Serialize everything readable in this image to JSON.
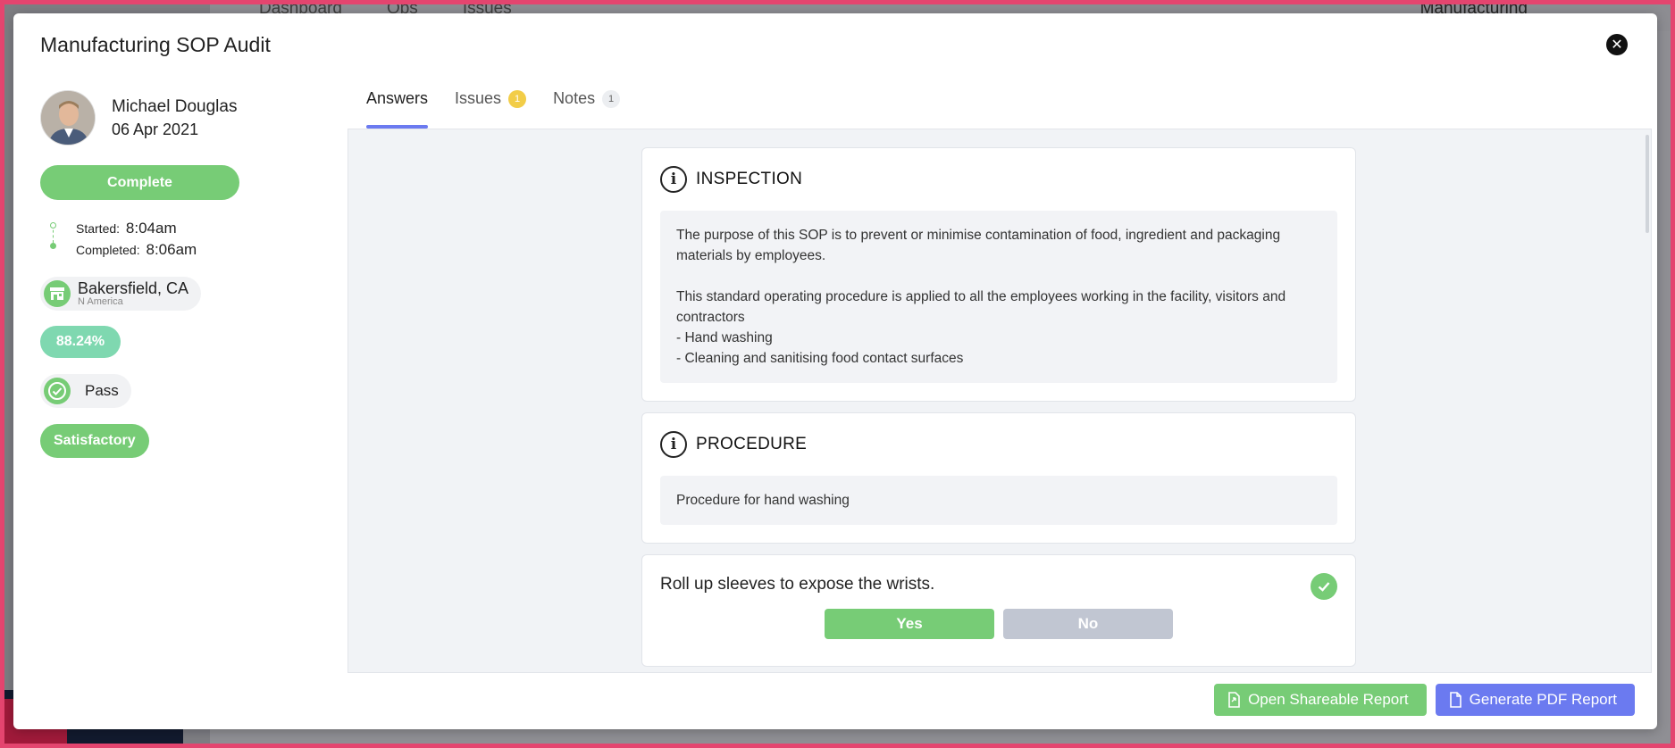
{
  "background": {
    "nav": [
      "Dashboard",
      "Ops",
      "Issues"
    ],
    "right_label": "Manufacturing"
  },
  "modal": {
    "title": "Manufacturing SOP Audit",
    "close_icon": "close-icon"
  },
  "user": {
    "name": "Michael Douglas",
    "date": "06 Apr 2021"
  },
  "status": {
    "complete_label": "Complete",
    "started_label": "Started:",
    "started_time": "8:04am",
    "completed_label": "Completed:",
    "completed_time": "8:06am"
  },
  "location": {
    "name": "Bakersfield, CA",
    "region": "N America"
  },
  "score": "88.24%",
  "result": "Pass",
  "rating": "Satisfactory",
  "tabs": [
    {
      "label": "Answers",
      "badge": ""
    },
    {
      "label": "Issues",
      "badge": "1"
    },
    {
      "label": "Notes",
      "badge": "1"
    }
  ],
  "sections": [
    {
      "title": "INSPECTION",
      "body": "The purpose of this SOP is to prevent or minimise contamination of food, ingredient and packaging materials by employees.\n\nThis standard operating procedure is applied to all the employees working in the facility, visitors and contractors\n- Hand washing\n- Cleaning and sanitising food contact surfaces"
    },
    {
      "title": "PROCEDURE",
      "body": "Procedure for hand washing"
    }
  ],
  "question": {
    "text": "Roll up sleeves to expose the wrists.",
    "yes_label": "Yes",
    "no_label": "No"
  },
  "footer": {
    "shareable_label": "Open Shareable Report",
    "pdf_label": "Generate PDF Report"
  },
  "colors": {
    "green": "#77cc76",
    "teal": "#7fd8b0",
    "blue": "#6b7af0",
    "yellow": "#f2cd48"
  }
}
